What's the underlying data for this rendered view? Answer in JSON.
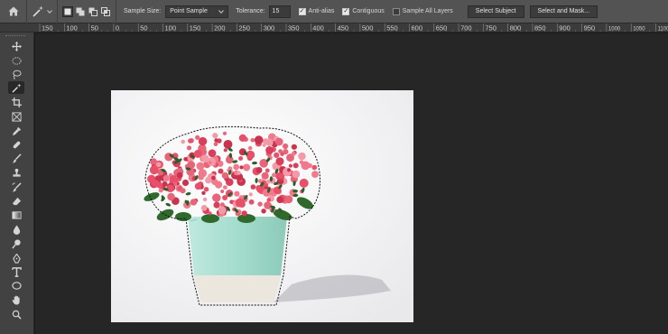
{
  "options_bar": {
    "home_icon": "home-icon",
    "tool_icon": "magic-wand-icon",
    "sample_size_label": "Sample Size:",
    "sample_size_value": "Point Sample",
    "tolerance_label": "Tolerance:",
    "tolerance_value": "15",
    "anti_alias_label": "Anti-alias",
    "anti_alias_checked": true,
    "contiguous_label": "Contiguous",
    "contiguous_checked": true,
    "sample_all_layers_label": "Sample All Layers",
    "sample_all_layers_checked": false,
    "select_subject_label": "Select Subject",
    "select_and_mask_label": "Select and Mask..."
  },
  "ruler": {
    "ticks": [
      "150",
      "100",
      "50",
      "0",
      "50",
      "100",
      "150",
      "200",
      "250",
      "300",
      "350",
      "400",
      "450",
      "500",
      "550",
      "600",
      "650",
      "700",
      "750",
      "800",
      "850",
      "900",
      "950",
      "1000",
      "1050",
      "1100"
    ]
  },
  "toolbar": {
    "tools": [
      "move-icon",
      "marquee-icon",
      "lasso-icon",
      "magic-wand-icon",
      "crop-icon",
      "frame-icon",
      "eyedropper-icon",
      "healing-brush-icon",
      "brush-icon",
      "clone-stamp-icon",
      "history-brush-icon",
      "eraser-icon",
      "gradient-icon",
      "blur-icon",
      "dodge-icon",
      "pen-icon",
      "type-icon",
      "ellipse-icon",
      "hand-icon"
    ],
    "active_tool": "magic-wand-icon"
  },
  "colors": {
    "pot": "#a8ddd0",
    "pot_base": "#ece8df",
    "flowers": "#e85a72",
    "leaves": "#2f6a2c",
    "canvas_bg": "#262626"
  }
}
